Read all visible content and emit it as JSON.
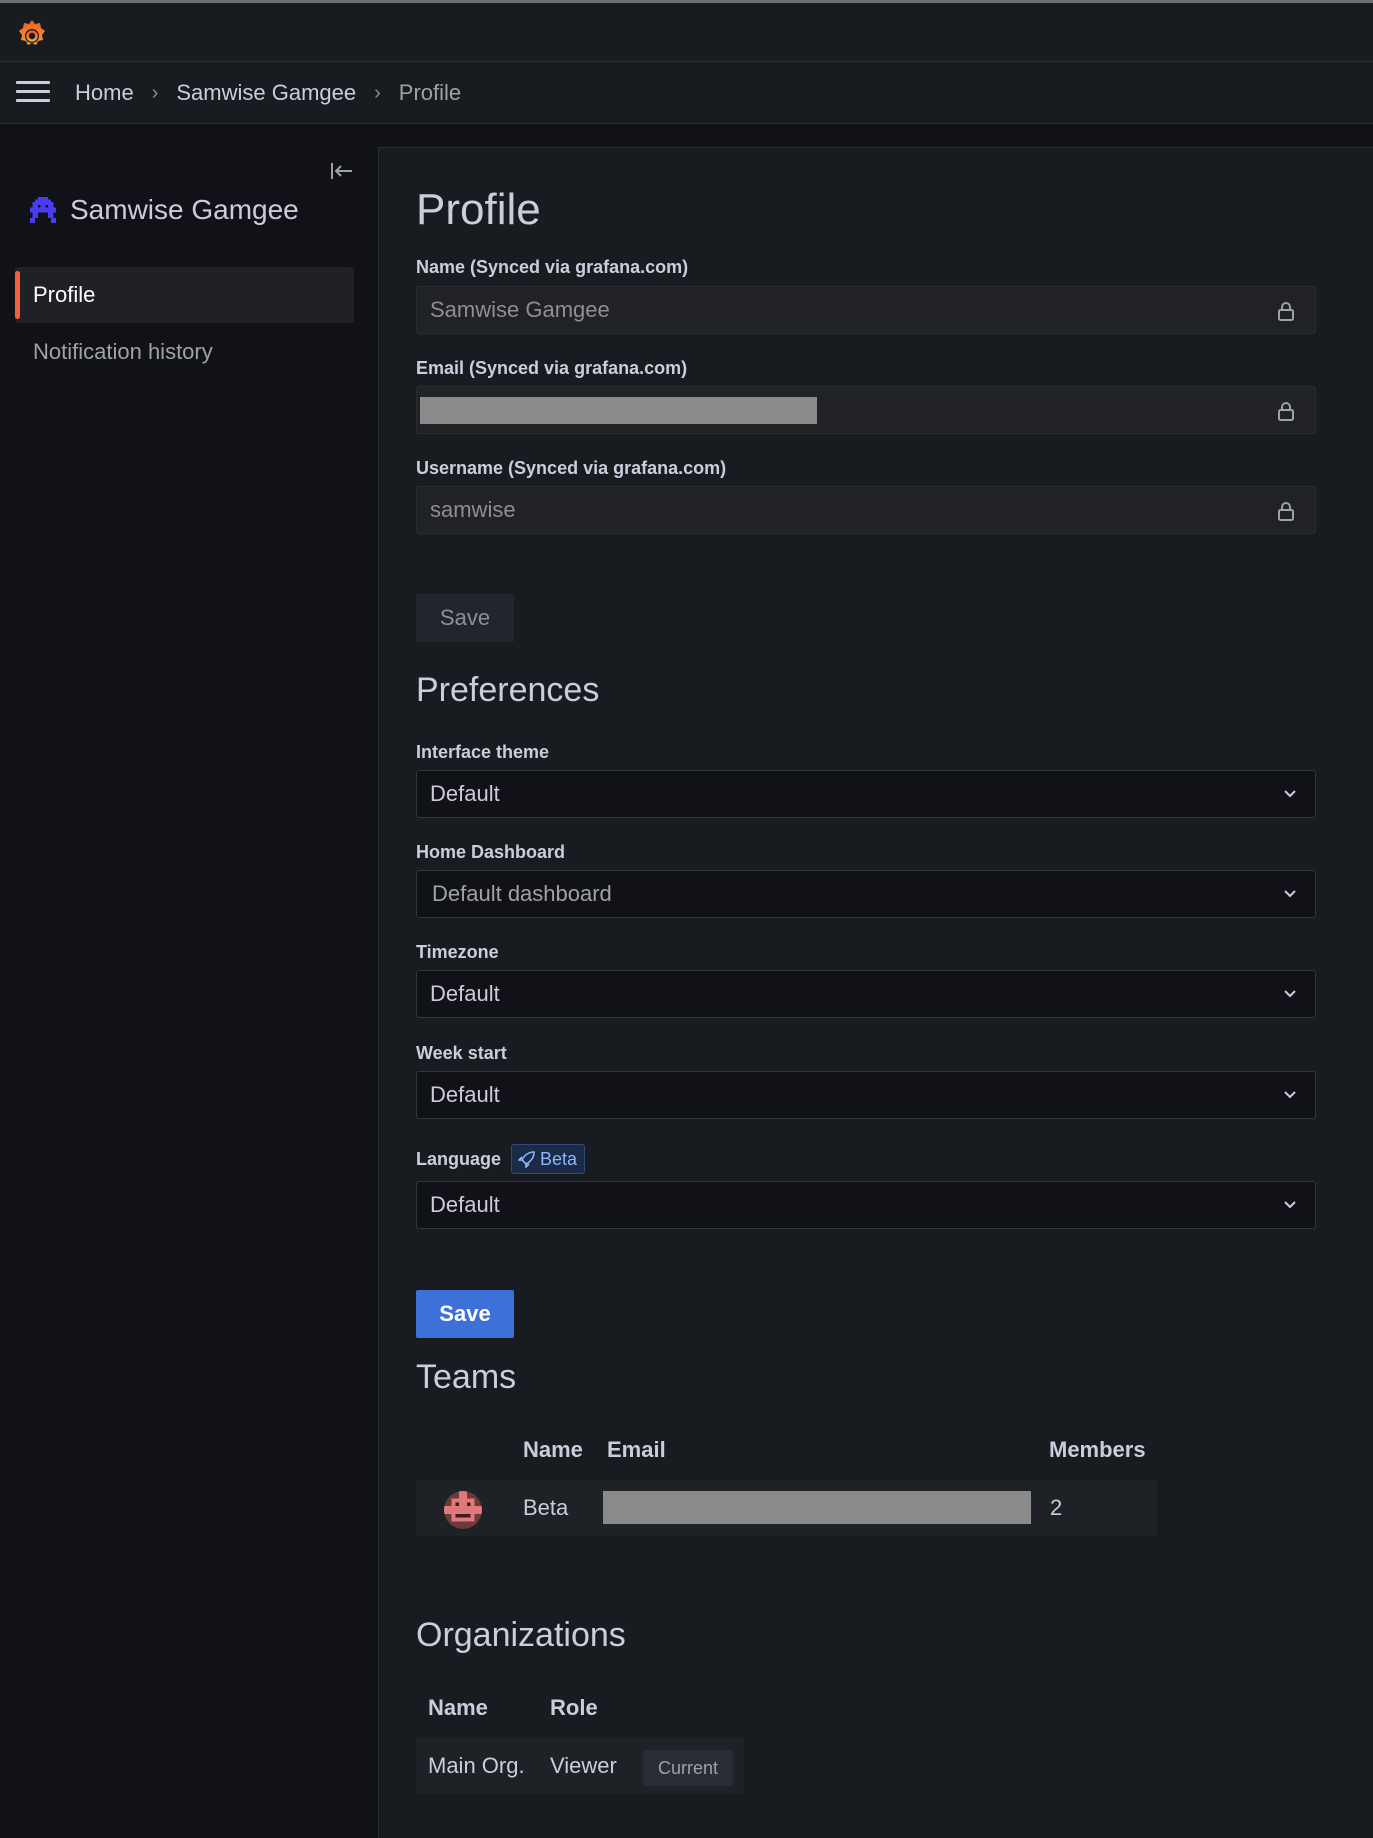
{
  "breadcrumb": {
    "home": "Home",
    "user": "Samwise Gamgee",
    "current": "Profile"
  },
  "sidebar": {
    "user_name": "Samwise Gamgee",
    "items": [
      {
        "label": "Profile",
        "active": true
      },
      {
        "label": "Notification history",
        "active": false
      }
    ]
  },
  "profile": {
    "title": "Profile",
    "name_label": "Name (Synced via grafana.com)",
    "name_value": "Samwise Gamgee",
    "email_label": "Email (Synced via grafana.com)",
    "username_label": "Username (Synced via grafana.com)",
    "username_value": "samwise",
    "save_label": "Save"
  },
  "preferences": {
    "title": "Preferences",
    "theme_label": "Interface theme",
    "theme_value": "Default",
    "home_dashboard_label": "Home Dashboard",
    "home_dashboard_placeholder": "Default dashboard",
    "timezone_label": "Timezone",
    "timezone_value": "Default",
    "week_start_label": "Week start",
    "week_start_value": "Default",
    "language_label": "Language",
    "beta_badge": "Beta",
    "language_value": "Default",
    "save_label": "Save"
  },
  "teams": {
    "title": "Teams",
    "columns": {
      "name": "Name",
      "email": "Email",
      "members": "Members"
    },
    "rows": [
      {
        "name": "Beta",
        "members": "2"
      }
    ]
  },
  "organizations": {
    "title": "Organizations",
    "columns": {
      "name": "Name",
      "role": "Role"
    },
    "rows": [
      {
        "name": "Main Org.",
        "role": "Viewer",
        "badge": "Current"
      }
    ]
  },
  "colors": {
    "accent_orange": "#f55f3e",
    "primary_blue": "#3d71d9",
    "background": "#111217",
    "panel": "#181b1f"
  },
  "icons": {
    "logo": "grafana-logo",
    "menu": "hamburger-icon",
    "collapse": "dock-left-icon",
    "lock": "lock-icon",
    "chevron": "chevron-down-icon",
    "rocket": "rocket-icon"
  }
}
